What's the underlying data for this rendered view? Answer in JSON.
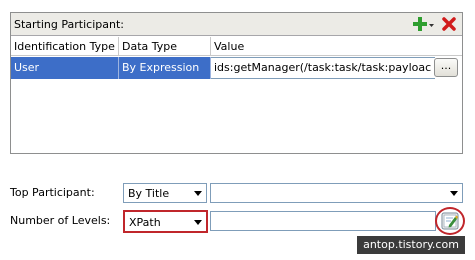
{
  "panel": {
    "title": "Starting Participant:",
    "add_icon": "plus-dropdown-icon",
    "remove_icon": "red-x-icon",
    "columns": [
      "Identification Type",
      "Data Type",
      "Value"
    ],
    "rows": [
      {
        "identification_type": "User",
        "data_type": "By Expression",
        "value": "ids:getManager(/task:task/task:payloac",
        "button": "..."
      }
    ]
  },
  "top_participant": {
    "label": "Top Participant:",
    "selected": "By Title",
    "value": ""
  },
  "number_of_levels": {
    "label": "Number of Levels:",
    "selected": "XPath",
    "value": "",
    "edit_icon": "expression-builder-icon"
  },
  "watermark": "antop.tistory.com",
  "colors": {
    "highlight": "#c0262b",
    "selection": "#3d6ec8",
    "add_green": "#2f9e2f",
    "remove_red": "#d11b1b"
  }
}
